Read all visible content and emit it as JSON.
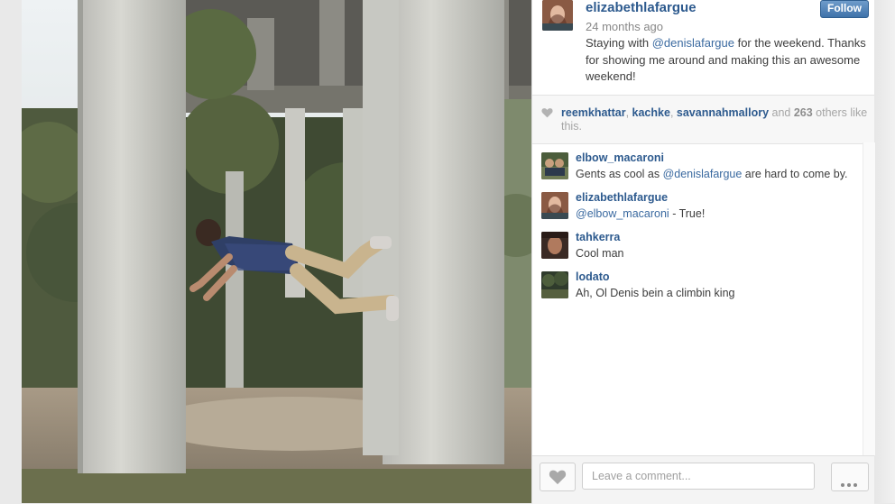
{
  "post": {
    "username": "elizabethlafargue",
    "follow_label": "Follow",
    "time_ago": "24 months ago",
    "caption_before": "Staying with ",
    "caption_mention": "@denislafargue",
    "caption_after": " for the weekend. Thanks for showing me around and making this an awesome weekend!"
  },
  "likes": {
    "user1": "reemkhattar",
    "sep1": ", ",
    "user2": "kachke",
    "sep2": ", ",
    "user3": "savannahmallory",
    "and_text": " and ",
    "count": "263",
    "others_text": " others like this."
  },
  "comments": [
    {
      "user": "elbow_macaroni",
      "text_before": "Gents as cool as ",
      "mention": "@denislafargue",
      "text_after": " are hard to come by."
    },
    {
      "user": "elizabethlafargue",
      "text_before": "",
      "mention": "@elbow_macaroni",
      "text_after": " - True!"
    },
    {
      "user": "tahkerra",
      "text_before": "Cool man",
      "mention": "",
      "text_after": ""
    },
    {
      "user": "lodato",
      "text_before": "Ah, Ol Denis bein a climbin king",
      "mention": "",
      "text_after": ""
    }
  ],
  "footer": {
    "comment_placeholder": "Leave a comment...",
    "like_icon": "heart-icon",
    "more_icon": "more-dots-icon"
  },
  "colors": {
    "username": "#2d5a8e",
    "follow_button": "#3f72a9",
    "mention": "#3b6aa0"
  }
}
